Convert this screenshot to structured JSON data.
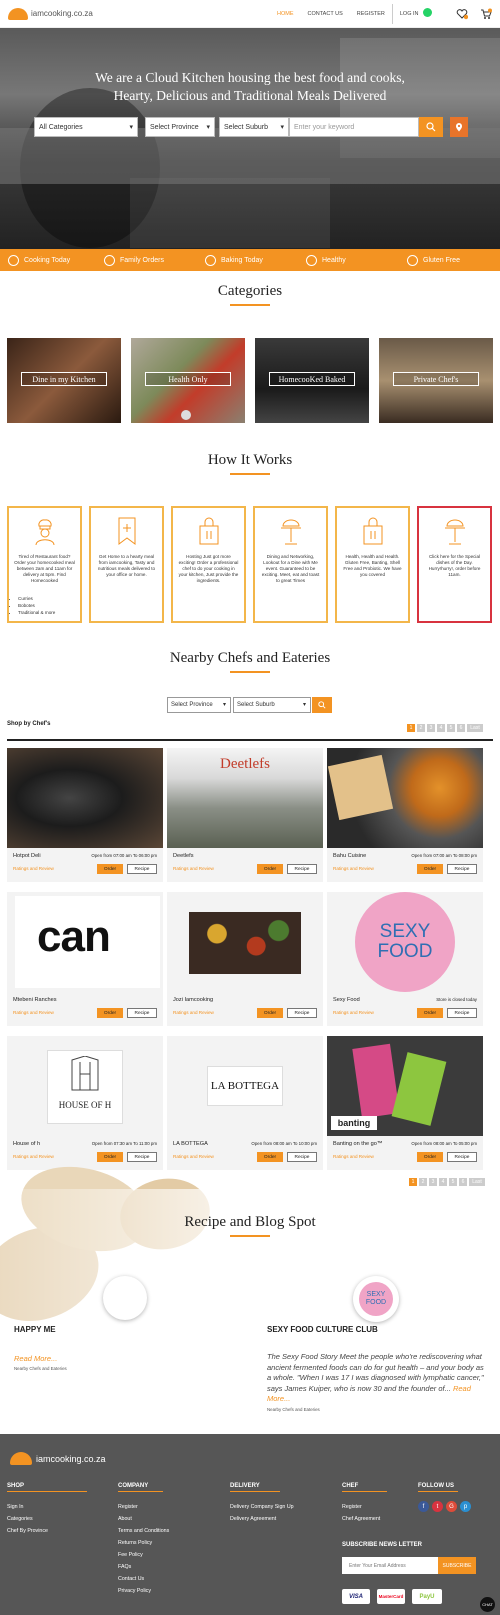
{
  "header": {
    "logo_text": "iamcooking.co.za",
    "nav": [
      "HOME",
      "CONTACT US",
      "REGISTER",
      "LOG IN"
    ],
    "active_nav": "HOME",
    "cart_badge": "0"
  },
  "hero": {
    "title_line1": "We are a Cloud Kitchen housing the best food and cooks,",
    "title_line2": "Hearty, Delicious and Traditional Meals Delivered",
    "search": {
      "category": "All Categories",
      "province": "Select Province",
      "suburb": "Select Suburb",
      "keyword_placeholder": "Enter your keyword"
    }
  },
  "strip": [
    "Cooking Today",
    "Family Orders",
    "Baking Today",
    "Healthy",
    "Gluten Free"
  ],
  "categories": {
    "title": "Categories",
    "items": [
      "Dine in my Kitchen",
      "Health Only",
      "HomecooKed Baked",
      "Private Chef's"
    ]
  },
  "how": {
    "title": "How It Works",
    "steps": [
      "Tired of Restaurant food? Order your homecooked meal between 2am and 11am for delivery at 5pm. Find Homecooked",
      "Get Home to a hearty meal from iamcooking, Tasty and nutritious meals delivered to your office or home.",
      "Hosting Just got more exciting! Order a professional chef to do your cooking in your kitchen, Just provide the ingredients.",
      "Dining and Networking, Lookout for a Dine with Me event. Guaranteed to be exciting. Meet, eat and toast to great Times",
      "Health, Health and Health. Gluten Free, Banting, Shell Free and Probiotic. We have you covered",
      "Click here for the Special dishes of the Day. Hurry!hurry!, order before 11am."
    ],
    "bullets": [
      "Curries",
      "Bobotes",
      "Traditional & more"
    ]
  },
  "nearby": {
    "title": "Nearby Chefs and Eateries",
    "province": "Select Province",
    "suburb": "Select Suburb",
    "shop_label": "Shop by Chef's",
    "pages": [
      "1",
      "2",
      "3",
      "4",
      "5",
      "6",
      "Last"
    ],
    "ratings_label": "Ratings and Review",
    "order_label": "Order",
    "recipe_label": "Recipe",
    "cards": [
      {
        "name": "Hotpot Deli",
        "hours": "Open from 07:00 am To 06:00 pm"
      },
      {
        "name": "Deetlefs",
        "hours": ""
      },
      {
        "name": "Bahu Cuisine",
        "hours": "Open from 07:00 am To 08:00 pm"
      },
      {
        "name": "Mtebeni Ranches",
        "hours": ""
      },
      {
        "name": "Jozi Iamcooking",
        "hours": ""
      },
      {
        "name": "Sexy Food",
        "hours": "Store is closed today"
      },
      {
        "name": "House of h",
        "hours": "Open from 07:30 am To 11:00 pm"
      },
      {
        "name": "LA BOTTEGA",
        "hours": "Open from 08:00 am To 10:00 pm"
      },
      {
        "name": "Banting on the go™",
        "hours": "Open from 08:00 am To 05:00 pm"
      }
    ],
    "logos": {
      "deetlefs": "Deetlefs",
      "can": "can",
      "sexy_food": "SEXY FOOD",
      "house_of_h": "HOUSE OF H",
      "bottega": "LA BOTTEGA",
      "banting": "banting"
    }
  },
  "blog": {
    "title": "Recipe and Blog Spot",
    "posts": [
      {
        "title": "HAPPY ME",
        "excerpt": "",
        "more": "Read More...",
        "by": "Nearby Chefs and Eateries"
      },
      {
        "title": "SEXY FOOD CULTURE CLUB",
        "excerpt": "The Sexy Food Story   Meet the people who're rediscovering what ancient fermented foods can do for gut health – and your body as a whole. \"When I was 17 I was diagnosed with lymphatic cancer,\" says James Kuiper, who is now 30 and the founder of...",
        "more": "Read More...",
        "by": "Nearby Chefs and Eateries"
      }
    ],
    "avatar2_text": "SEXY FOOD"
  },
  "footer": {
    "logo_text": "iamcooking.co.za",
    "cols": [
      {
        "head": "SHOP",
        "links": [
          "Sign In",
          "Categories",
          "Chef By Province"
        ]
      },
      {
        "head": "COMPANY",
        "links": [
          "Register",
          "About",
          "Terms and Conditions",
          "Returns Policy",
          "Fee Policy",
          "FAQs",
          "Contact Us",
          "Privacy Policy"
        ]
      },
      {
        "head": "DELIVERY",
        "links": [
          "Delivery Company Sign Up",
          "Delivery Agreement"
        ]
      },
      {
        "head": "CHEF",
        "links": [
          "Register",
          "Chef Agreement"
        ]
      },
      {
        "head": "FOLLOW US",
        "links": []
      }
    ],
    "newsletter": {
      "head": "SUBSCRIBE NEWS LETTER",
      "placeholder": "Enter Your Email Address",
      "button": "SUBSCRIBE"
    },
    "payments": [
      "VISA",
      "MasterCard",
      "PayU"
    ],
    "chat": "CHAT"
  },
  "colors": {
    "accent": "#f39322",
    "footer": "#565656",
    "red": "#d8333f"
  }
}
